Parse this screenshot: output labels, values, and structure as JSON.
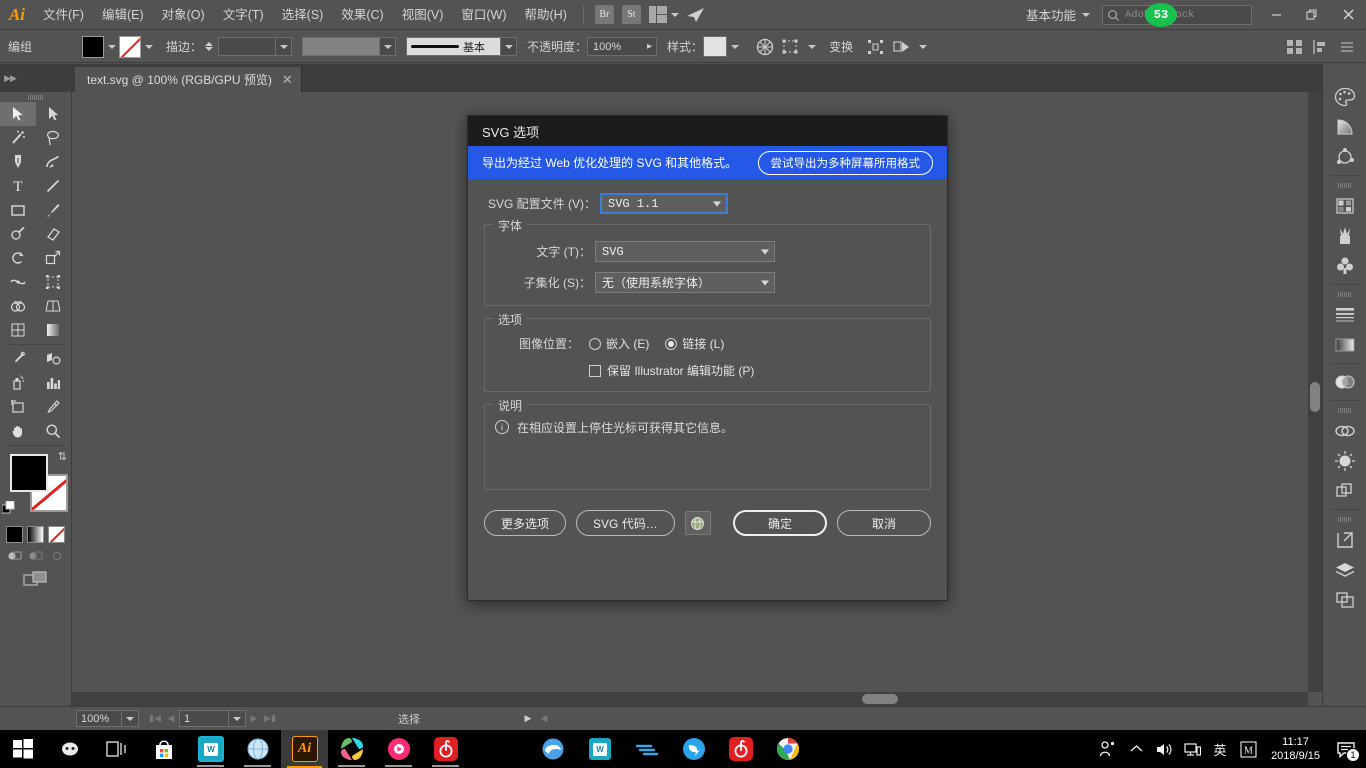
{
  "app": {
    "logo": "Ai",
    "menus": [
      {
        "label": "文件(F)",
        "name": "menu-file"
      },
      {
        "label": "编辑(E)",
        "name": "menu-edit"
      },
      {
        "label": "对象(O)",
        "name": "menu-object"
      },
      {
        "label": "文字(T)",
        "name": "menu-type"
      },
      {
        "label": "选择(S)",
        "name": "menu-select"
      },
      {
        "label": "效果(C)",
        "name": "menu-effect"
      },
      {
        "label": "视图(V)",
        "name": "menu-view"
      },
      {
        "label": "窗口(W)",
        "name": "menu-window"
      },
      {
        "label": "帮助(H)",
        "name": "menu-help"
      }
    ],
    "bridge_label": "Br",
    "stock_label": "St",
    "workspace": "基本功能",
    "search_placeholder": "Adobe Stock",
    "notification_count": "53",
    "accent": "#ff9a00"
  },
  "controlbar": {
    "selection_label": "编组",
    "stroke_label": "描边：",
    "stroke_weight": "",
    "brush_label": "基本",
    "opacity_label": "不透明度：",
    "opacity_value": "100%",
    "style_label": "样式：",
    "transform_label": "变换"
  },
  "tab": {
    "title": "text.svg @ 100% (RGB/GPU 预览)",
    "close": "✕"
  },
  "toolbox": {
    "tools": [
      {
        "name": "selection-tool",
        "label": "选择工具"
      },
      {
        "name": "direct-selection-tool",
        "label": "直接选择工具"
      },
      {
        "name": "magic-wand-tool",
        "label": "魔棒工具"
      },
      {
        "name": "lasso-tool",
        "label": "套索工具"
      },
      {
        "name": "pen-tool",
        "label": "钢笔工具"
      },
      {
        "name": "curvature-tool",
        "label": "曲率工具"
      },
      {
        "name": "type-tool",
        "label": "文字工具"
      },
      {
        "name": "line-segment-tool",
        "label": "直线段工具"
      },
      {
        "name": "rectangle-tool",
        "label": "矩形工具"
      },
      {
        "name": "paintbrush-tool",
        "label": "画笔工具"
      },
      {
        "name": "shaper-tool",
        "label": "Shaper 工具"
      },
      {
        "name": "eraser-tool",
        "label": "橡皮擦工具"
      },
      {
        "name": "rotate-tool",
        "label": "旋转工具"
      },
      {
        "name": "scale-tool",
        "label": "比例缩放工具"
      },
      {
        "name": "width-tool",
        "label": "宽度工具"
      },
      {
        "name": "free-transform-tool",
        "label": "自由变换工具"
      },
      {
        "name": "shape-builder-tool",
        "label": "形状生成器工具"
      },
      {
        "name": "perspective-grid-tool",
        "label": "透视网格工具"
      },
      {
        "name": "mesh-tool",
        "label": "网格工具"
      },
      {
        "name": "gradient-tool",
        "label": "渐变工具"
      },
      {
        "name": "eyedropper-tool",
        "label": "吸管工具"
      },
      {
        "name": "blend-tool",
        "label": "混合工具"
      },
      {
        "name": "symbol-sprayer-tool",
        "label": "符号喷枪工具"
      },
      {
        "name": "column-graph-tool",
        "label": "柱形图工具"
      },
      {
        "name": "artboard-tool",
        "label": "画板工具"
      },
      {
        "name": "slice-tool",
        "label": "切片工具"
      },
      {
        "name": "hand-tool",
        "label": "抓手工具"
      },
      {
        "name": "zoom-tool",
        "label": "缩放工具"
      }
    ],
    "fill_color": "#000000",
    "stroke_color": "none"
  },
  "dock": {
    "items": [
      {
        "name": "color-panel-icon",
        "label": "颜色"
      },
      {
        "name": "gradient-panel-icon",
        "label": "渐变"
      },
      {
        "name": "color-guide-panel-icon",
        "label": "颜色参考"
      },
      {
        "name": "swatches-panel-icon",
        "label": "色板"
      },
      {
        "name": "brushes-panel-icon",
        "label": "画笔"
      },
      {
        "name": "symbols-panel-icon",
        "label": "符号"
      },
      {
        "name": "stroke-panel-icon",
        "label": "描边"
      },
      {
        "name": "gradient-fill-panel-icon",
        "label": "渐变填色"
      },
      {
        "name": "transparency-panel-icon",
        "label": "透明度"
      },
      {
        "name": "links-panel-icon",
        "label": "链接"
      },
      {
        "name": "appearance-panel-icon",
        "label": "外观"
      },
      {
        "name": "pathfinder-panel-icon",
        "label": "路径查找器"
      },
      {
        "name": "export-panel-icon",
        "label": "资源导出"
      },
      {
        "name": "layers-panel-icon",
        "label": "图层"
      },
      {
        "name": "artboards-panel-icon",
        "label": "画板"
      }
    ]
  },
  "statusbar": {
    "zoom": "100%",
    "artboard": "1",
    "status_text": "选择"
  },
  "dialog": {
    "title": "SVG 选项",
    "banner_text": "导出为经过 Web 优化处理的 SVG 和其他格式。",
    "banner_button": "尝试导出为多种屏幕所用格式",
    "banner_color": "#2558e6",
    "profile_label": "SVG 配置文件 (V)：",
    "profile_value": "SVG 1.1",
    "fonts_group": "字体",
    "type_label": "文字 (T)：",
    "type_value": "SVG",
    "subset_label": "子集化 (S)：",
    "subset_value": "无（使用系统字体）",
    "options_group": "选项",
    "image_location_label": "图像位置：",
    "radio_embed": "嵌入 (E)",
    "radio_link": "链接 (L)",
    "radio_selected": "link",
    "checkbox_preserve": "保留 Illustrator 编辑功能 (P)",
    "checkbox_checked": false,
    "description_group": "说明",
    "description_text": "在相应设置上停住光标可获得其它信息。",
    "btn_more_options": "更多选项",
    "btn_svg_code": "SVG 代码…",
    "btn_ok": "确定",
    "btn_cancel": "取消"
  },
  "taskbar": {
    "apps": [
      {
        "name": "taskbar-start",
        "label": "开始"
      },
      {
        "name": "taskbar-cortana",
        "label": "搜索"
      },
      {
        "name": "taskbar-task-view",
        "label": "任务视图"
      },
      {
        "name": "taskbar-store",
        "label": "应用商店"
      },
      {
        "name": "taskbar-wps",
        "label": "WPS"
      },
      {
        "name": "taskbar-browser",
        "label": "浏览器"
      },
      {
        "name": "taskbar-illustrator",
        "label": "Illustrator"
      },
      {
        "name": "taskbar-photos",
        "label": "照片"
      },
      {
        "name": "taskbar-media",
        "label": "播放器"
      },
      {
        "name": "taskbar-netease-music",
        "label": "网易云音乐"
      }
    ],
    "pinned": [
      {
        "name": "taskbar-edge",
        "label": "Edge"
      },
      {
        "name": "taskbar-wps-writer",
        "label": "WPS 文字"
      },
      {
        "name": "taskbar-thunder",
        "label": "迅雷"
      },
      {
        "name": "taskbar-dingtalk",
        "label": "钉钉"
      },
      {
        "name": "taskbar-netease",
        "label": "网易"
      },
      {
        "name": "taskbar-chrome",
        "label": "Chrome"
      }
    ],
    "tray": {
      "ime": "英",
      "ime_mode": "M",
      "time": "11:17",
      "date": "2018/9/15",
      "notification_count": "1"
    }
  }
}
